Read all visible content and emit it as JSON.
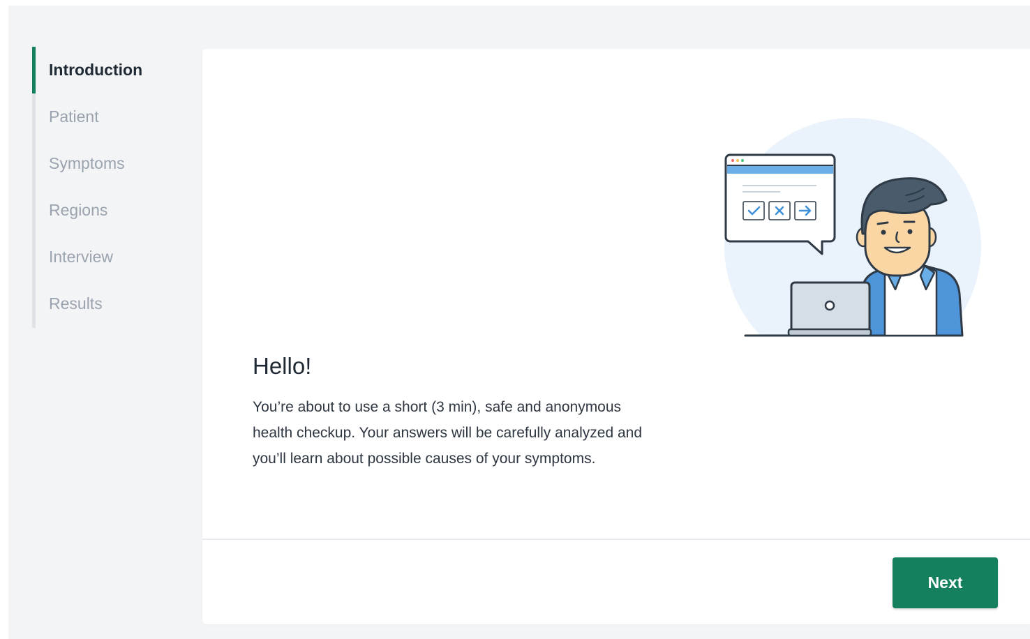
{
  "sidebar": {
    "steps": [
      {
        "label": "Introduction",
        "active": true
      },
      {
        "label": "Patient",
        "active": false
      },
      {
        "label": "Symptoms",
        "active": false
      },
      {
        "label": "Regions",
        "active": false
      },
      {
        "label": "Interview",
        "active": false
      },
      {
        "label": "Results",
        "active": false
      }
    ]
  },
  "main": {
    "title": "Hello!",
    "text": "You’re about to use a short (3 min), safe and anonymous health checkup. Your answers will be carefully analyzed and you’ll learn about possible causes of your symptoms."
  },
  "footer": {
    "next_label": "Next"
  },
  "colors": {
    "accent": "#14805e",
    "background": "#f3f4f6",
    "inactive_step": "#9aa3ae"
  },
  "icons": [
    "check-icon",
    "close-icon",
    "arrow-right-icon"
  ]
}
